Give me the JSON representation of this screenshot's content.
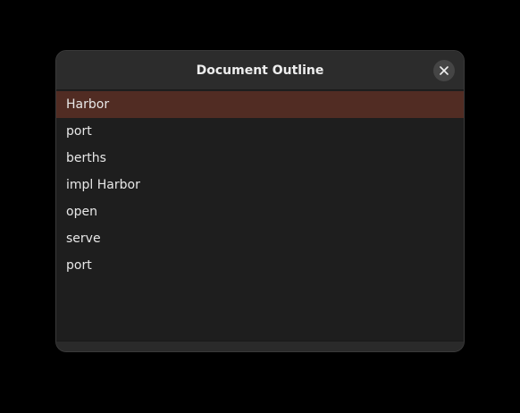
{
  "dialog": {
    "title": "Document Outline",
    "close_icon": "close-icon"
  },
  "outline": {
    "selected_index": 0,
    "items": [
      {
        "label": "Harbor"
      },
      {
        "label": "port"
      },
      {
        "label": "berths"
      },
      {
        "label": "impl Harbor"
      },
      {
        "label": "open"
      },
      {
        "label": "serve"
      },
      {
        "label": "port"
      }
    ]
  },
  "colors": {
    "selection": "#512c23",
    "background": "#1e1e1e",
    "header": "#2c2c2c"
  }
}
